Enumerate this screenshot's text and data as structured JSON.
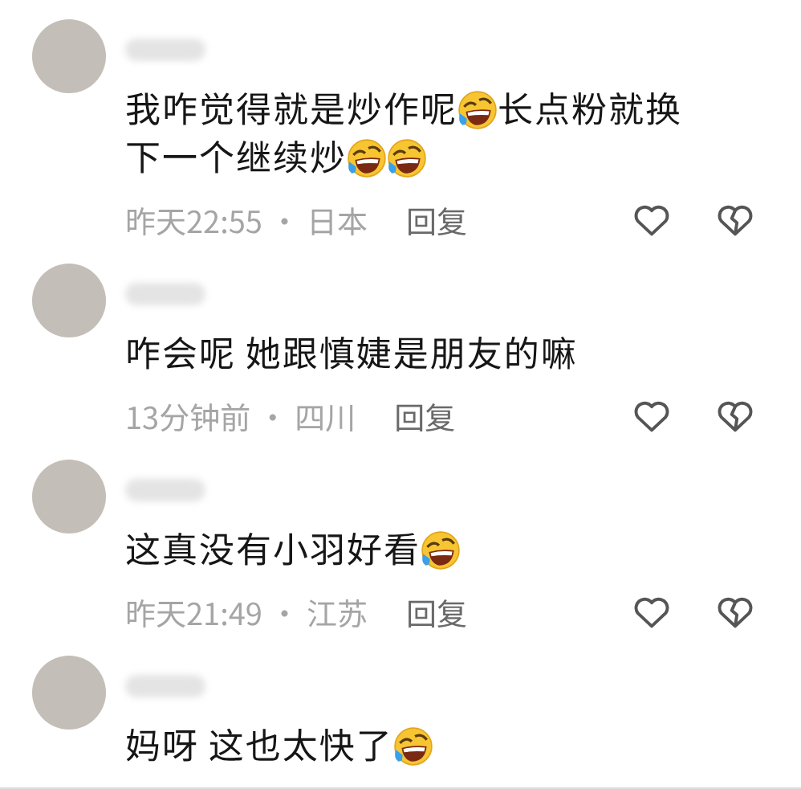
{
  "comments": [
    {
      "parts": [
        {
          "kind": "text",
          "text": "我咋觉得就是炒作呢"
        },
        {
          "kind": "emoji"
        },
        {
          "kind": "text",
          "text": "长点粉就换"
        },
        {
          "kind": "text",
          "text": "下一个继续炒"
        },
        {
          "kind": "emoji"
        },
        {
          "kind": "emoji"
        }
      ],
      "info": "昨天22:55 · 日本",
      "reply": "回复"
    },
    {
      "parts": [
        {
          "kind": "text",
          "text": "咋会呢 她跟慎婕是朋友的嘛"
        }
      ],
      "info": "13分钟前 · 四川",
      "reply": "回复"
    },
    {
      "parts": [
        {
          "kind": "text",
          "text": "这真没有小羽好看"
        },
        {
          "kind": "emoji"
        }
      ],
      "info": "昨天21:49 · 江苏",
      "reply": "回复"
    },
    {
      "parts": [
        {
          "kind": "text",
          "text": "妈呀 这也太快了"
        },
        {
          "kind": "emoji"
        }
      ]
    }
  ]
}
